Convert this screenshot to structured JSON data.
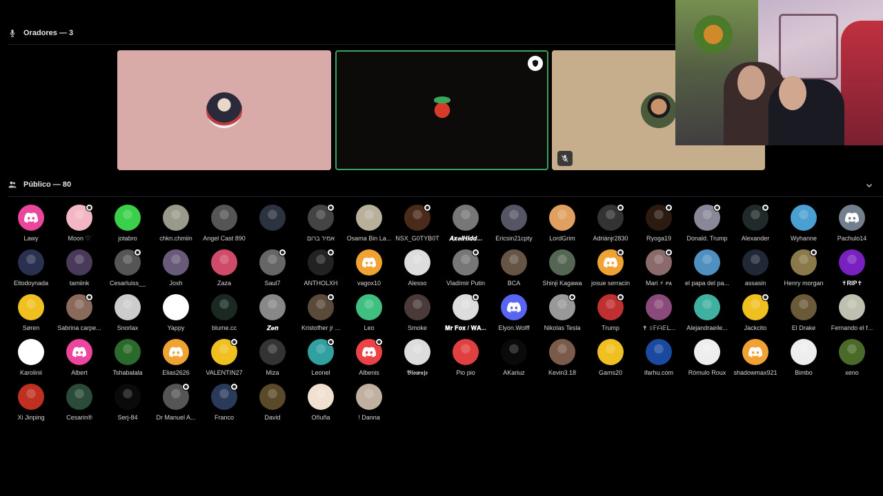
{
  "speakers": {
    "header": "Oradores — 3"
  },
  "audience": {
    "header": "Público — 80"
  },
  "colors": {
    "discord_blurple": "#5865f2",
    "discord_pink": "#eb459e",
    "discord_orange": "#f0a232",
    "discord_red": "#ed4245",
    "discord_grey": "#747f8d"
  },
  "members": [
    {
      "name": "Lawy",
      "av": "discord",
      "color": "#eb459e"
    },
    {
      "name": "Moon ♡",
      "av": "photo",
      "color": "#f2b6c4",
      "badge": true
    },
    {
      "name": "jotabro",
      "av": "photo",
      "color": "#3ad04a"
    },
    {
      "name": "chkn.chmiin",
      "av": "photo",
      "color": "#9a9a8a"
    },
    {
      "name": "Angel Cast 890",
      "av": "photo",
      "color": "#555"
    },
    {
      "name": "",
      "av": "photo",
      "color": "#2c3340"
    },
    {
      "name": "אמיר ברום",
      "av": "photo",
      "color": "#444",
      "badge": true
    },
    {
      "name": "Osama Bin La...",
      "av": "photo",
      "color": "#b8b09a"
    },
    {
      "name": "NSX_G0TYB0T",
      "av": "photo",
      "color": "#4a2a1a",
      "badge": true
    },
    {
      "name": "𝑨𝒙𝒆𝒍𝑯𝒊𝒅𝒅...",
      "av": "photo",
      "color": "#777",
      "bold": true
    },
    {
      "name": "Ericsin21cpty",
      "av": "photo",
      "color": "#556"
    },
    {
      "name": "LordGrim",
      "av": "photo",
      "color": "#e0a060"
    },
    {
      "name": "Adriánjr2830",
      "av": "photo",
      "color": "#333",
      "badge": true
    },
    {
      "name": "Ryoga19",
      "av": "photo",
      "color": "#2a1a10",
      "badge": true
    },
    {
      "name": "Donald. Trump",
      "av": "photo",
      "color": "#889",
      "badge": true
    },
    {
      "name": "Alexander",
      "av": "photo",
      "color": "#202a2a",
      "badge": true
    },
    {
      "name": "Wyhanne",
      "av": "photo",
      "color": "#4aa0d0"
    },
    {
      "name": "Pachulo14",
      "av": "discord",
      "color": "#747f8d"
    },
    {
      "name": "Eltodoynada",
      "av": "photo",
      "color": "#2a3050"
    },
    {
      "name": "tamiink",
      "av": "photo",
      "color": "#4a3a5a"
    },
    {
      "name": "Cesarluiss__",
      "av": "photo",
      "color": "#555",
      "badge": true
    },
    {
      "name": "Joxh",
      "av": "photo",
      "color": "#6a5a7a"
    },
    {
      "name": "Zaza",
      "av": "photo",
      "color": "#d04a6a"
    },
    {
      "name": "Saul7",
      "av": "photo",
      "color": "#666",
      "badge": true
    },
    {
      "name": "ANTHOLXH",
      "av": "photo",
      "color": "#222",
      "badge": true
    },
    {
      "name": "vagox10",
      "av": "discord",
      "color": "#f0a232"
    },
    {
      "name": "Alesso",
      "av": "photo",
      "color": "#ddd"
    },
    {
      "name": "Vladímir Putin",
      "av": "photo",
      "color": "#777",
      "badge": true
    },
    {
      "name": "BCA",
      "av": "photo",
      "color": "#665544"
    },
    {
      "name": "Shinji Kagawa",
      "av": "photo",
      "color": "#556655"
    },
    {
      "name": "josue serracin",
      "av": "discord",
      "color": "#f0a232",
      "badge": true
    },
    {
      "name": "Mari ⚡ ᴘᴀ",
      "av": "photo",
      "color": "#8a6a6a",
      "badge": true
    },
    {
      "name": "el papa del pa...",
      "av": "photo",
      "color": "#5090c0"
    },
    {
      "name": "assasin",
      "av": "photo",
      "color": "#202838"
    },
    {
      "name": "Henry morgan",
      "av": "photo",
      "color": "#8a7a4a",
      "badge": true
    },
    {
      "name": "✝RIP✝",
      "av": "photo",
      "color": "#7a20c0",
      "bold": true
    },
    {
      "name": "Søren",
      "av": "photo",
      "color": "#f0c020"
    },
    {
      "name": "Sabrina carpe...",
      "av": "photo",
      "color": "#8a6a5a",
      "badge": true
    },
    {
      "name": "Snorlax",
      "av": "photo",
      "color": "#ccc"
    },
    {
      "name": "Yappy",
      "av": "photo",
      "color": "#fff"
    },
    {
      "name": "blume.cc",
      "av": "photo",
      "color": "#1a2a22"
    },
    {
      "name": "𝒁𝒆𝒏",
      "av": "photo",
      "color": "#888",
      "bold": true
    },
    {
      "name": "Kristofher jr ...",
      "av": "photo",
      "color": "#5a4a3a",
      "badge": true
    },
    {
      "name": "Leo",
      "av": "photo",
      "color": "#40c080"
    },
    {
      "name": "Smoke",
      "av": "photo",
      "color": "#4a3a3a"
    },
    {
      "name": "𝐌𝐫 𝐅𝐨𝐱 / 𝐖𝐀...",
      "av": "photo",
      "color": "#ddd",
      "badge": true,
      "bold": true
    },
    {
      "name": "Elyon.Wolff",
      "av": "discord",
      "color": "#5865f2"
    },
    {
      "name": "Nikolas Tesla",
      "av": "photo",
      "color": "#999",
      "badge": true
    },
    {
      "name": "Trump",
      "av": "photo",
      "color": "#c03030",
      "badge": true
    },
    {
      "name": "✝ ᛟ𝔽ᗩ𝔼ᒪ...",
      "av": "photo",
      "color": "#8a4a7a"
    },
    {
      "name": "Alejandraeile...",
      "av": "photo",
      "color": "#40b0a0"
    },
    {
      "name": "Jackcito",
      "av": "photo",
      "color": "#f0c020",
      "badge": true
    },
    {
      "name": "El Drake",
      "av": "photo",
      "color": "#6a5a3a"
    },
    {
      "name": "Fernando el f...",
      "av": "photo",
      "color": "#c0c0b0"
    },
    {
      "name": "Karolinii",
      "av": "photo",
      "color": "#fff"
    },
    {
      "name": "Albert",
      "av": "discord",
      "color": "#eb459e"
    },
    {
      "name": "Tshabalala",
      "av": "photo",
      "color": "#2a6a2a"
    },
    {
      "name": "Elias2626",
      "av": "discord",
      "color": "#f0a232"
    },
    {
      "name": "VALENTIN27",
      "av": "photo",
      "color": "#f0c020",
      "badge": true
    },
    {
      "name": "Miza",
      "av": "photo",
      "color": "#333"
    },
    {
      "name": "Leonel",
      "av": "photo",
      "color": "#30a0a0",
      "badge": true
    },
    {
      "name": "Albenis",
      "av": "discord",
      "color": "#ed4245",
      "badge": true
    },
    {
      "name": "𝕭𝖑𝖔𝖜𝖓𝖏𝖊",
      "av": "photo",
      "color": "#ddd"
    },
    {
      "name": "Pio pio",
      "av": "photo",
      "color": "#e04040"
    },
    {
      "name": "AKariuz",
      "av": "photo",
      "color": "#0a0a0a"
    },
    {
      "name": "Kevin3.18",
      "av": "photo",
      "color": "#7a5a4a"
    },
    {
      "name": "Gams20",
      "av": "photo",
      "color": "#f0c020"
    },
    {
      "name": "ifarhu.com",
      "av": "photo",
      "color": "#1a4aa0"
    },
    {
      "name": "Rómulo Roux",
      "av": "photo",
      "color": "#eee"
    },
    {
      "name": "shadowmax921",
      "av": "discord",
      "color": "#f0a232"
    },
    {
      "name": "Bimbo",
      "av": "photo",
      "color": "#eee"
    },
    {
      "name": "xeno",
      "av": "photo",
      "color": "#4a6a2a"
    },
    {
      "name": "Xi Jinping",
      "av": "photo",
      "color": "#c03020"
    },
    {
      "name": "Cesarin®",
      "av": "photo",
      "color": "#2a4a3a"
    },
    {
      "name": "Serj-84",
      "av": "photo",
      "color": "#0a0a0a"
    },
    {
      "name": "Dr Manuel A...",
      "av": "photo",
      "color": "#555",
      "badge": true
    },
    {
      "name": "Franco",
      "av": "photo",
      "color": "#2a3a5a",
      "badge": true
    },
    {
      "name": "David",
      "av": "photo",
      "color": "#5a4a2a"
    },
    {
      "name": "Oñuña",
      "av": "photo",
      "color": "#f0e0d0"
    },
    {
      "name": "! Danna",
      "av": "photo",
      "color": "#c0b0a0"
    }
  ]
}
